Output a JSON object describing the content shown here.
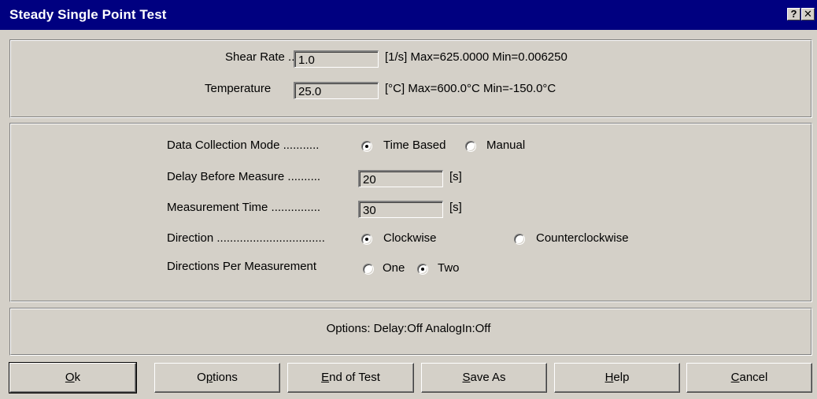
{
  "window": {
    "title": "Steady Single Point Test",
    "help_glyph": "?",
    "close_glyph": "✕"
  },
  "setpoints": {
    "shear_rate": {
      "label": "Shear Rate ..",
      "value": "1.0",
      "limits": "[1/s] Max=625.0000  Min=0.006250"
    },
    "temperature": {
      "label": "Temperature",
      "value": "25.0",
      "limits": "[°C] Max=600.0°C  Min=-150.0°C"
    }
  },
  "settings": {
    "data_collection_mode": {
      "label": "Data Collection Mode ...........",
      "options": [
        "Time Based",
        "Manual"
      ],
      "selected": "Time Based"
    },
    "delay_before_measure": {
      "label": "Delay Before Measure ..........",
      "value": "20",
      "unit": "[s]"
    },
    "measurement_time": {
      "label": "Measurement Time ...............",
      "value": "30",
      "unit": "[s]"
    },
    "direction": {
      "label": "Direction .................................",
      "options": [
        "Clockwise",
        "Counterclockwise"
      ],
      "selected": "Clockwise"
    },
    "directions_per_measurement": {
      "label": "Directions Per Measurement",
      "options": [
        "One",
        "Two"
      ],
      "selected": "Two"
    }
  },
  "options_summary": "Options:  Delay:Off  AnalogIn:Off",
  "buttons": [
    {
      "first": "O",
      "rest": "k"
    },
    {
      "first": "",
      "mid_u": "p",
      "before": "O",
      "after": "tions"
    },
    {
      "first": "E",
      "rest": "nd of Test"
    },
    {
      "first": "S",
      "rest": "ave As"
    },
    {
      "first": "H",
      "rest": "elp"
    },
    {
      "first": "C",
      "rest": "ancel"
    }
  ]
}
